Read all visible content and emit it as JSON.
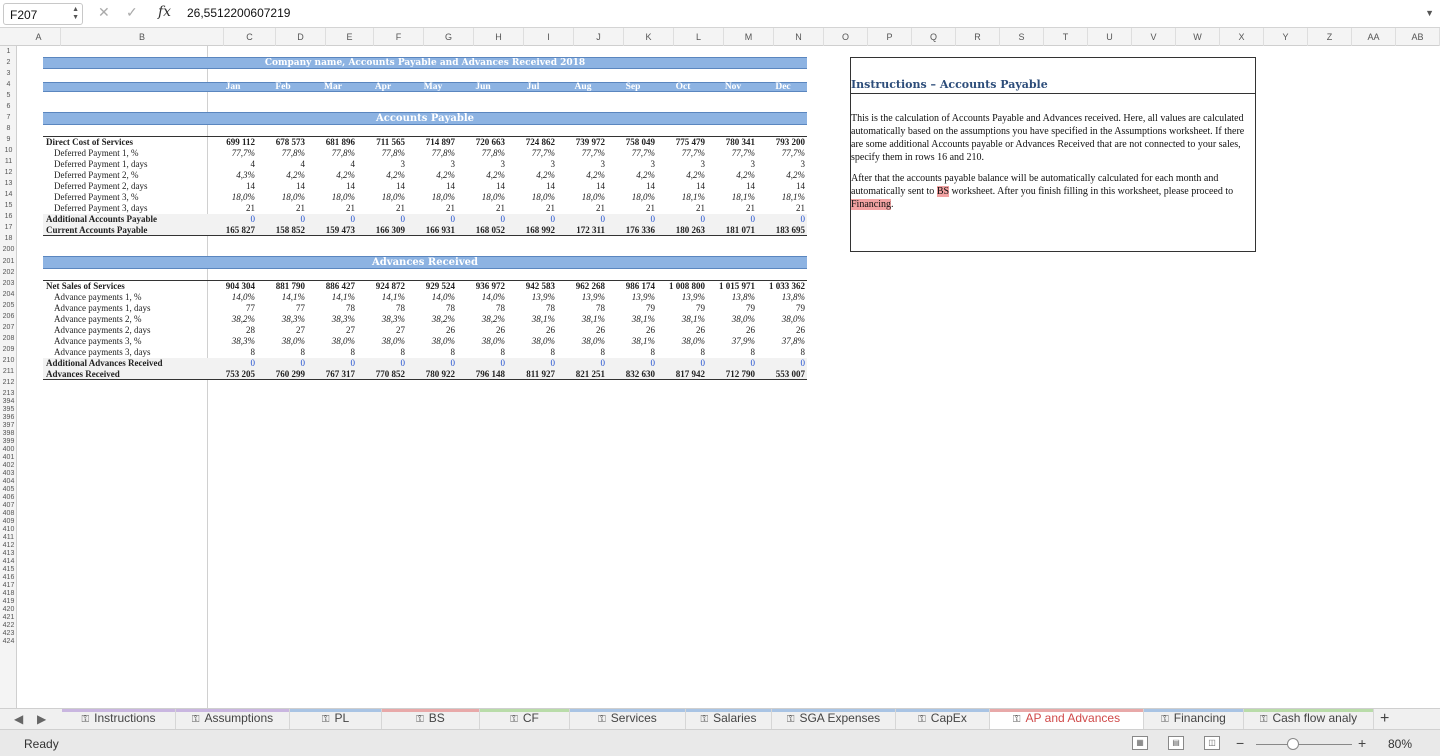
{
  "namebox": "F207",
  "formula": "26,5512200607219",
  "columns": [
    "A",
    "B",
    "C",
    "D",
    "E",
    "F",
    "G",
    "H",
    "I",
    "J",
    "K",
    "L",
    "M",
    "N",
    "O",
    "P",
    "Q",
    "R",
    "S",
    "T",
    "U",
    "V",
    "W",
    "X",
    "Y",
    "Z",
    "AA",
    "AB"
  ],
  "row_numbers": [
    "1",
    "2",
    "3",
    "4",
    "5",
    "6",
    "7",
    "8",
    "9",
    "10",
    "11",
    "12",
    "13",
    "14",
    "15",
    "16",
    "17",
    "18",
    "200",
    "201",
    "202",
    "203",
    "204",
    "205",
    "206",
    "207",
    "208",
    "209",
    "210",
    "211",
    "212",
    "213",
    "394",
    "395",
    "396",
    "397",
    "398",
    "399",
    "400",
    "401",
    "402",
    "403",
    "404",
    "405",
    "406",
    "407",
    "408",
    "409",
    "410",
    "411",
    "412",
    "413",
    "414",
    "415",
    "416",
    "417",
    "418",
    "419",
    "420",
    "421",
    "422",
    "423",
    "424"
  ],
  "sheet": {
    "title": "Company name, Accounts Payable and Advances Received 2018",
    "months": [
      "Jan",
      "Feb",
      "Mar",
      "Apr",
      "May",
      "Jun",
      "Jul",
      "Aug",
      "Sep",
      "Oct",
      "Nov",
      "Dec"
    ],
    "ap": {
      "header": "Accounts Payable",
      "rows": [
        {
          "label": "Direct Cost of Services",
          "style": "b",
          "values": [
            "699 112",
            "678 573",
            "681 896",
            "711 565",
            "714 897",
            "720 663",
            "724 862",
            "739 972",
            "758 049",
            "775 479",
            "780 341",
            "793 200"
          ]
        },
        {
          "label": "Deferred Payment 1, %",
          "style": "i",
          "values": [
            "77,7%",
            "77,8%",
            "77,8%",
            "77,8%",
            "77,8%",
            "77,8%",
            "77,7%",
            "77,7%",
            "77,7%",
            "77,7%",
            "77,7%",
            "77,7%"
          ]
        },
        {
          "label": "Deferred Payment 1, days",
          "style": "n",
          "values": [
            "4",
            "4",
            "4",
            "3",
            "3",
            "3",
            "3",
            "3",
            "3",
            "3",
            "3",
            "3"
          ]
        },
        {
          "label": "Deferred Payment 2, %",
          "style": "i",
          "values": [
            "4,3%",
            "4,2%",
            "4,2%",
            "4,2%",
            "4,2%",
            "4,2%",
            "4,2%",
            "4,2%",
            "4,2%",
            "4,2%",
            "4,2%",
            "4,2%"
          ]
        },
        {
          "label": "Deferred Payment 2, days",
          "style": "n",
          "values": [
            "14",
            "14",
            "14",
            "14",
            "14",
            "14",
            "14",
            "14",
            "14",
            "14",
            "14",
            "14"
          ]
        },
        {
          "label": "Deferred Payment 3, %",
          "style": "i",
          "values": [
            "18,0%",
            "18,0%",
            "18,0%",
            "18,0%",
            "18,0%",
            "18,0%",
            "18,0%",
            "18,0%",
            "18,0%",
            "18,1%",
            "18,1%",
            "18,1%"
          ]
        },
        {
          "label": "Deferred Payment 3, days",
          "style": "n",
          "values": [
            "21",
            "21",
            "21",
            "21",
            "21",
            "21",
            "21",
            "21",
            "21",
            "21",
            "21",
            "21"
          ]
        },
        {
          "label": "Additional Accounts Payable",
          "style": "blue",
          "values": [
            "0",
            "0",
            "0",
            "0",
            "0",
            "0",
            "0",
            "0",
            "0",
            "0",
            "0",
            "0"
          ]
        },
        {
          "label": "Current Accounts Payable",
          "style": "b",
          "values": [
            "165 827",
            "158 852",
            "159 473",
            "166 309",
            "166 931",
            "168 052",
            "168 992",
            "172 311",
            "176 336",
            "180 263",
            "181 071",
            "183 695"
          ]
        }
      ]
    },
    "adv": {
      "header": "Advances Received",
      "rows": [
        {
          "label": "Net Sales of Services",
          "style": "b",
          "values": [
            "904 304",
            "881 790",
            "886 427",
            "924 872",
            "929 524",
            "936 972",
            "942 583",
            "962 268",
            "986 174",
            "1 008 800",
            "1 015 971",
            "1 033 362"
          ]
        },
        {
          "label": "Advance payments 1, %",
          "style": "i",
          "values": [
            "14,0%",
            "14,1%",
            "14,1%",
            "14,1%",
            "14,0%",
            "14,0%",
            "13,9%",
            "13,9%",
            "13,9%",
            "13,9%",
            "13,8%",
            "13,8%"
          ]
        },
        {
          "label": "Advance payments 1, days",
          "style": "n",
          "values": [
            "77",
            "77",
            "78",
            "78",
            "78",
            "78",
            "78",
            "78",
            "79",
            "79",
            "79",
            "79"
          ]
        },
        {
          "label": "Advance payments 2, %",
          "style": "i",
          "values": [
            "38,2%",
            "38,3%",
            "38,3%",
            "38,3%",
            "38,2%",
            "38,2%",
            "38,1%",
            "38,1%",
            "38,1%",
            "38,1%",
            "38,0%",
            "38,0%"
          ]
        },
        {
          "label": "Advance payments 2, days",
          "style": "n",
          "values": [
            "28",
            "27",
            "27",
            "27",
            "26",
            "26",
            "26",
            "26",
            "26",
            "26",
            "26",
            "26"
          ]
        },
        {
          "label": "Advance payments 3, %",
          "style": "i",
          "values": [
            "38,3%",
            "38,0%",
            "38,0%",
            "38,0%",
            "38,0%",
            "38,0%",
            "38,0%",
            "38,0%",
            "38,1%",
            "38,0%",
            "37,9%",
            "37,8%"
          ]
        },
        {
          "label": "Advance payments 3, days",
          "style": "n",
          "values": [
            "8",
            "8",
            "8",
            "8",
            "8",
            "8",
            "8",
            "8",
            "8",
            "8",
            "8",
            "8"
          ]
        },
        {
          "label": "Additional Advances Received",
          "style": "blue",
          "values": [
            "0",
            "0",
            "0",
            "0",
            "0",
            "0",
            "0",
            "0",
            "0",
            "0",
            "0",
            "0"
          ]
        },
        {
          "label": "Advances Received",
          "style": "b",
          "values": [
            "753 205",
            "760 299",
            "767 317",
            "770 852",
            "780 922",
            "796 148",
            "811 927",
            "821 251",
            "832 630",
            "817 942",
            "712 790",
            "553 007"
          ]
        }
      ]
    }
  },
  "instructions": {
    "title": "Instructions – Accounts Payable",
    "p1": "This is the calculation of Accounts Payable and Advances received. Here, all values are calculated automatically based on the assumptions you have specified in the Assumptions worksheet. If there are some additional Accounts payable or Advances Received that are not connected to your sales, specify them in rows 16 and 210.",
    "p2_a": "After that the accounts payable balance will be automatically calculated for each month and automatically sent to ",
    "p2_link1": "BS",
    "p2_b": " worksheet. After you finish filling in this worksheet, please proceed to ",
    "p2_link2": "Financing",
    "p2_c": "."
  },
  "tabs": [
    {
      "label": "Instructions",
      "color": "#c9b6e0"
    },
    {
      "label": "Assumptions",
      "color": "#c9b6e0"
    },
    {
      "label": "PL",
      "color": "#a9c4e4"
    },
    {
      "label": "BS",
      "color": "#e8a9a9"
    },
    {
      "label": "CF",
      "color": "#b9dca9"
    },
    {
      "label": "Services",
      "color": "#a9c4e4"
    },
    {
      "label": "Salaries",
      "color": "#a9c4e4"
    },
    {
      "label": "SGA Expenses",
      "color": "#a9c4e4"
    },
    {
      "label": "CapEx",
      "color": "#a9c4e4"
    },
    {
      "label": "AP and Advances",
      "color": "#e8a9a9",
      "active": true
    },
    {
      "label": "Financing",
      "color": "#a9c4e4"
    },
    {
      "label": "Cash flow analy",
      "color": "#b9dca9"
    }
  ],
  "status": {
    "ready": "Ready",
    "zoom": "80%"
  }
}
